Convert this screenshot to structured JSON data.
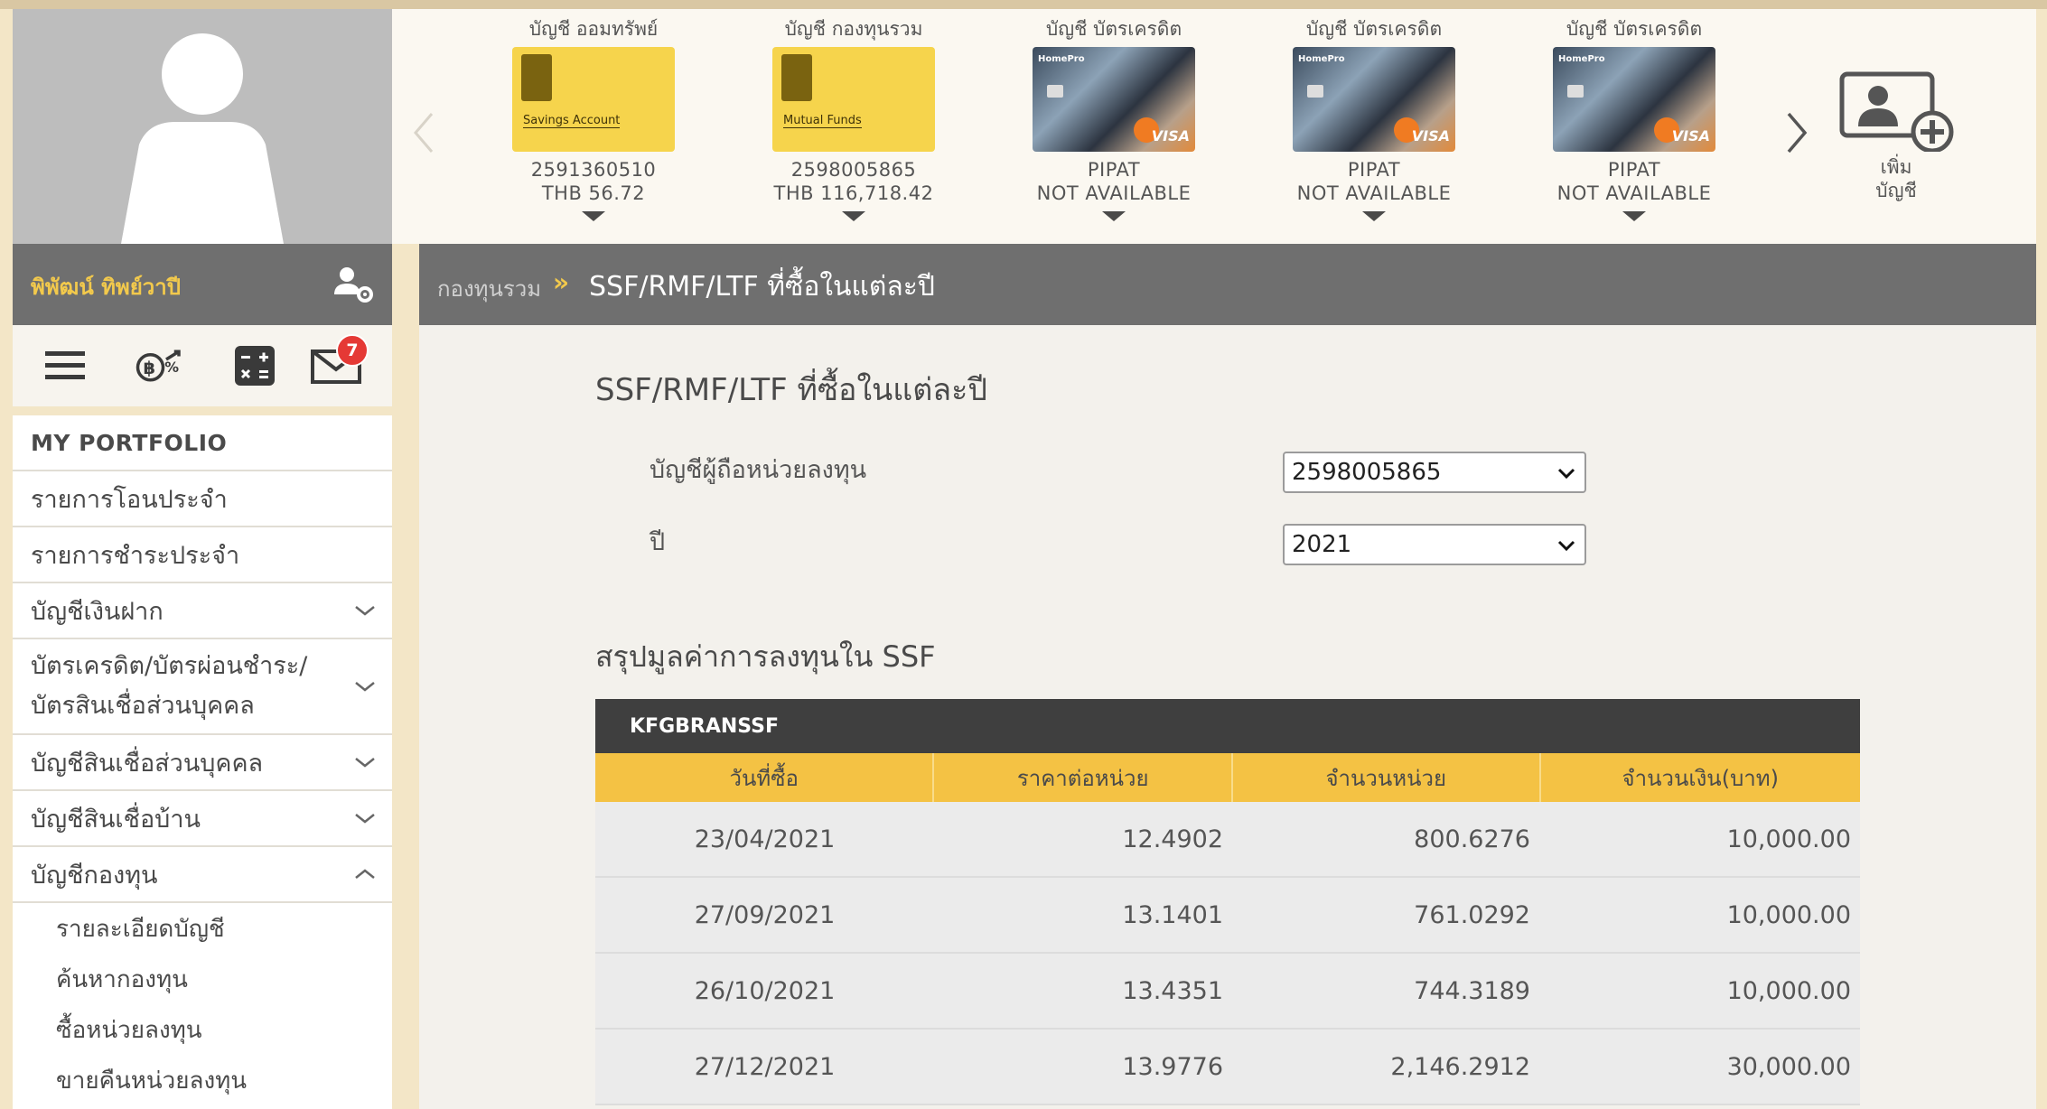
{
  "user": {
    "name": "พิพัฒน์ ทิพย์วาปี"
  },
  "icons": [
    "menu-icon",
    "investment-icon",
    "calculator-icon",
    "mail-icon"
  ],
  "mail_badge": "7",
  "accounts": [
    {
      "type": "บัญชี ออมทรัพย์",
      "card_label": "Savings Account",
      "line1": "2591360510",
      "line2": "THB 56.72"
    },
    {
      "type": "บัญชี กองทุนรวม",
      "card_label": "Mutual Funds",
      "line1": "2598005865",
      "line2": "THB 116,718.42"
    },
    {
      "type": "บัญชี บัตรเครดิต",
      "card_label": "HomePro",
      "line1": "PIPAT",
      "line2": "NOT AVAILABLE"
    },
    {
      "type": "บัญชี บัตรเครดิต",
      "card_label": "HomePro",
      "line1": "PIPAT",
      "line2": "NOT AVAILABLE"
    },
    {
      "type": "บัญชี บัตรเครดิต",
      "card_label": "HomePro",
      "line1": "PIPAT",
      "line2": "NOT AVAILABLE"
    }
  ],
  "add_account": {
    "line1": "เพิ่ม",
    "line2": "บัญชี"
  },
  "menu": [
    {
      "label": "MY PORTFOLIO"
    },
    {
      "label": "รายการโอนประจำ"
    },
    {
      "label": "รายการชำระประจำ"
    },
    {
      "label": "บัญชีเงินฝาก"
    },
    {
      "label": "บัตรเครดิต/บัตรผ่อนชำระ/บัตรสินเชื่อส่วนบุคคล"
    },
    {
      "label": "บัญชีสินเชื่อส่วนบุคคล"
    },
    {
      "label": "บัญชีสินเชื่อบ้าน"
    },
    {
      "label": "บัญชีกองทุน"
    }
  ],
  "submenu": [
    "รายละเอียดบัญชี",
    "ค้นหากองทุน",
    "ซื้อหน่วยลงทุน",
    "ขายคืนหน่วยลงทุน"
  ],
  "breadcrumb": {
    "parent": "กองทุนรวม",
    "separator": "»",
    "current": "SSF/RMF/LTF ที่ซื้อในแต่ละปี"
  },
  "page_title": "SSF/RMF/LTF ที่ซื้อในแต่ละปี",
  "form": {
    "account_label": "บัญชีผู้ถือหน่วยลงทุน",
    "account_value": "2598005865",
    "year_label": "ปี",
    "year_value": "2021"
  },
  "summary_title": "สรุปมูลค่าการลงทุนใน SSF",
  "table": {
    "fund": "KFGBRANSSF",
    "headers": [
      "วันที่ซื้อ",
      "ราคาต่อหน่วย",
      "จำนวนหน่วย",
      "จำนวนเงิน(บาท)"
    ],
    "rows": [
      [
        "23/04/2021",
        "12.4902",
        "800.6276",
        "10,000.00"
      ],
      [
        "27/09/2021",
        "13.1401",
        "761.0292",
        "10,000.00"
      ],
      [
        "26/10/2021",
        "13.4351",
        "744.3189",
        "10,000.00"
      ],
      [
        "27/12/2021",
        "13.9776",
        "2,146.2912",
        "30,000.00"
      ]
    ]
  }
}
